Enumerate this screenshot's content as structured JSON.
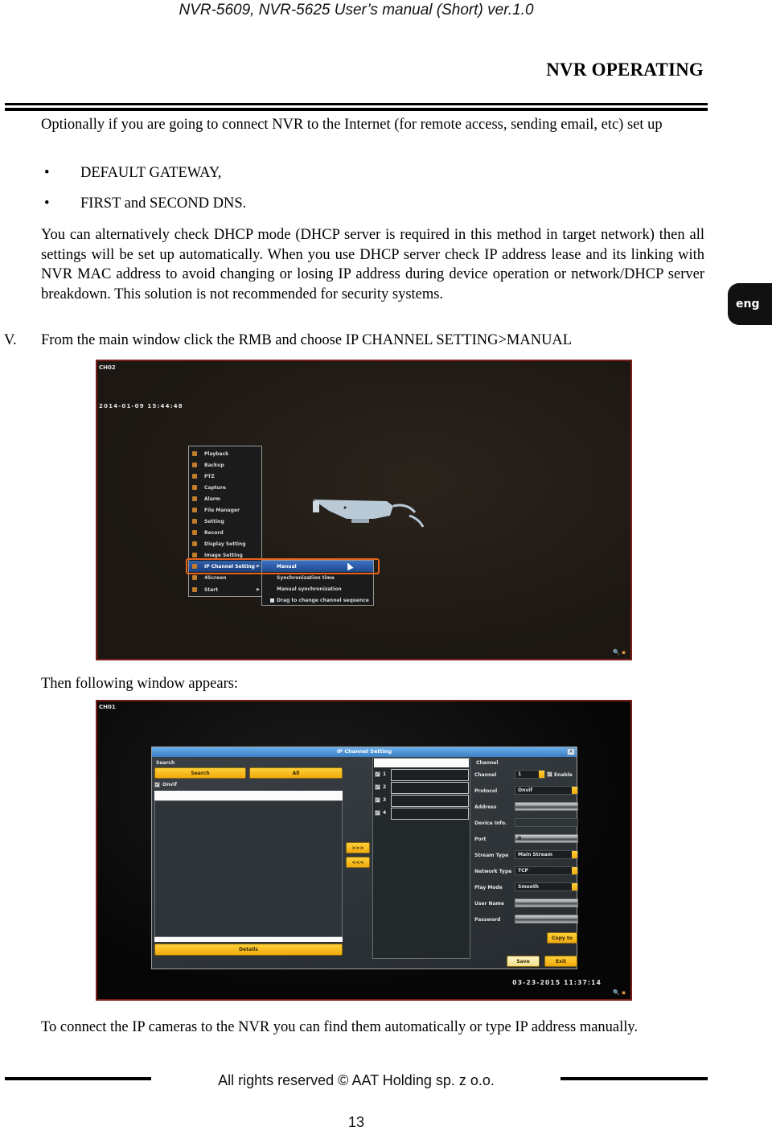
{
  "header": {
    "running_head": "NVR-5609, NVR-5625 User’s manual (Short) ver.1.0",
    "section_title": "NVR OPERATING"
  },
  "side_tab": {
    "label": "eng"
  },
  "content": {
    "intro": "Optionally if you are going to connect NVR to the Internet (for remote access, sending email, etc) set up",
    "bullets": [
      "DEFAULT GATEWAY,",
      "FIRST and SECOND DNS."
    ],
    "dhcp_paragraph": "You can alternatively check DHCP mode (DHCP server is required in this method in target network) then all settings will be set up automatically. When you use DHCP server check IP address lease and its linking with NVR MAC address to avoid changing or losing IP address during device operation or network/DHCP server breakdown. This solution is not recommended for security systems.",
    "step": {
      "number": "V.",
      "text": "From the main window click the RMB and choose IP CHANNEL SETTING>MANUAL"
    },
    "then_text": "Then following window appears:",
    "closing": "To connect the IP cameras to the NVR you can find them automatically or type IP address manually."
  },
  "screenshot1": {
    "channel": "CH02",
    "datetime": "2014-01-09 15:44:48",
    "context_menu": [
      {
        "label": "Playback",
        "icon": "playback-icon"
      },
      {
        "label": "Backup",
        "icon": "backup-icon"
      },
      {
        "label": "PTZ",
        "icon": "ptz-icon"
      },
      {
        "label": "Capture",
        "icon": "capture-icon"
      },
      {
        "label": "Alarm",
        "icon": "alarm-icon"
      },
      {
        "label": "File Manager",
        "icon": "file-manager-icon"
      },
      {
        "label": "Setting",
        "icon": "setting-icon"
      },
      {
        "label": "Record",
        "icon": "record-icon"
      },
      {
        "label": "Display Setting",
        "icon": "display-icon"
      },
      {
        "label": "Image Setting",
        "icon": "image-icon"
      },
      {
        "label": "IP Channel Setting",
        "icon": "ip-icon",
        "selected": true,
        "submenu": true
      },
      {
        "label": "4Screen",
        "icon": "grid-icon"
      },
      {
        "label": "Start",
        "icon": "home-icon",
        "submenu": true
      }
    ],
    "submenu": [
      {
        "label": "Manual",
        "selected": true
      },
      {
        "label": "Synchronization time"
      },
      {
        "label": "Manual synchronization"
      },
      {
        "label": "Drag to change channel sequence",
        "checkbox": true
      }
    ]
  },
  "screenshot2": {
    "channel": "CH01",
    "datetime": "03-23-2015 11:37:14",
    "dialog": {
      "title": "IP Channel Setting",
      "close": "×",
      "search_section": "Search",
      "search_button": "Search",
      "all_button": "All",
      "onvif_label": "Onvif",
      "onvif_checked": true,
      "details_button": "Details",
      "add_button": ">>>",
      "remove_button": "<<<",
      "channel_rows": [
        {
          "num": "1",
          "checked": true
        },
        {
          "num": "2",
          "checked": true
        },
        {
          "num": "3",
          "checked": true
        },
        {
          "num": "4",
          "checked": true
        }
      ],
      "channel_section": "Channel",
      "fields": {
        "channel_label": "Channel",
        "channel_value": "1",
        "enable_label": "Enable",
        "enable_checked": true,
        "protocol_label": "Protocol",
        "protocol_value": "Onvif",
        "address_label": "Address",
        "address_value": "",
        "device_info_label": "Device Info.",
        "device_info_value": "",
        "port_label": "Port",
        "port_value": "0",
        "stream_type_label": "Stream Type",
        "stream_type_value": "Main Stream",
        "network_type_label": "Network Type",
        "network_type_value": "TCP",
        "play_mode_label": "Play Mode",
        "play_mode_value": "Smooth",
        "user_name_label": "User Name",
        "user_name_value": "",
        "password_label": "Password",
        "password_value": ""
      },
      "copy_to_button": "Copy to",
      "save_button": "Save",
      "exit_button": "Exit"
    }
  },
  "footer": {
    "copyright": "All rights reserved © AAT Holding sp. z o.o.",
    "page_number": "13"
  }
}
